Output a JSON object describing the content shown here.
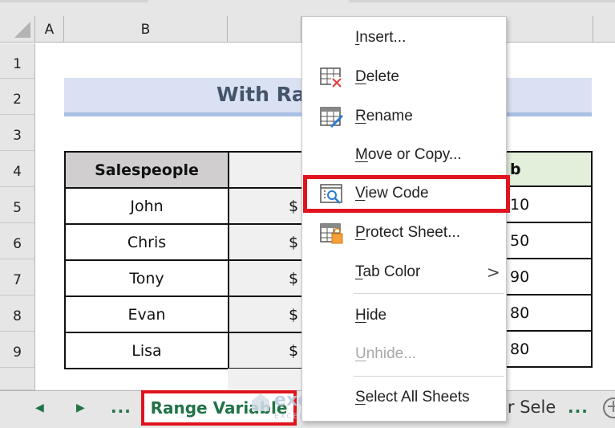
{
  "spreadsheet": {
    "columns": [
      "A",
      "B"
    ],
    "rows": [
      "1",
      "2",
      "3",
      "4",
      "5",
      "6",
      "7",
      "8",
      "9"
    ],
    "title_visible": "With Ra",
    "table": {
      "header_col1": "Salespeople",
      "header_col3_fragment": "b",
      "rows": [
        {
          "name": "John",
          "currency": "$",
          "right_fragment": "10"
        },
        {
          "name": "Chris",
          "currency": "$",
          "right_fragment": "50"
        },
        {
          "name": "Tony",
          "currency": "$",
          "right_fragment": "90"
        },
        {
          "name": "Evan",
          "currency": "$",
          "right_fragment": "80"
        },
        {
          "name": "Lisa",
          "currency": "$",
          "right_fragment": "80"
        }
      ]
    }
  },
  "context_menu": {
    "items": [
      {
        "label": "Insert...",
        "accel": "I",
        "icon": null,
        "enabled": true
      },
      {
        "label": "Delete",
        "accel": "D",
        "icon": "delete-sheet-icon",
        "enabled": true
      },
      {
        "label": "Rename",
        "accel": "R",
        "icon": "rename-sheet-icon",
        "enabled": true
      },
      {
        "label": "Move or Copy...",
        "accel": "M",
        "icon": null,
        "enabled": true
      },
      {
        "label": "View Code",
        "accel": "V",
        "icon": "view-code-icon",
        "enabled": true,
        "highlighted": true
      },
      {
        "label": "Protect Sheet...",
        "accel": "P",
        "icon": "protect-sheet-icon",
        "enabled": true
      },
      {
        "label": "Tab Color",
        "accel": "T",
        "icon": null,
        "enabled": true,
        "submenu": true
      },
      {
        "label": "Hide",
        "accel": "H",
        "icon": null,
        "enabled": true
      },
      {
        "label": "Unhide...",
        "accel": "U",
        "icon": null,
        "enabled": false
      },
      {
        "label": "Select All Sheets",
        "accel": "S",
        "icon": null,
        "enabled": true
      }
    ],
    "submenu_arrow": ">"
  },
  "sheet_tabs": {
    "prev": "◀",
    "next": "▶",
    "more_left": "...",
    "active": "Range Variable",
    "partial_tab": "er Sele",
    "more_right": "...",
    "add": "+"
  },
  "watermark": {
    "brand": "exceldemy",
    "tagline": "EXCEL · DATA · BI"
  },
  "colors": {
    "highlight": "#e0141e",
    "excel_green": "#217346"
  }
}
